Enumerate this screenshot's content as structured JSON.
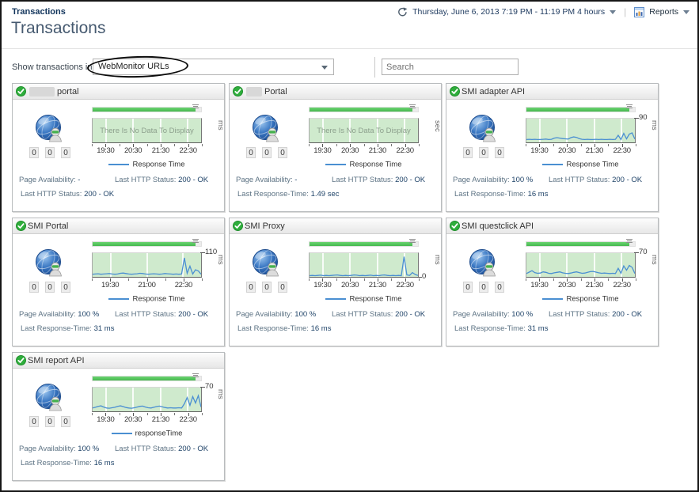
{
  "page": {
    "breadcrumb": "Transactions",
    "title": "Transactions",
    "time_range": "Thursday, June 6, 2013 7:19 PM - 11:19 PM 4 hours",
    "reports_label": "Reports",
    "filter_label": "Show transactions in",
    "filter_value": "WebMonitor URLs",
    "search_placeholder": "Search"
  },
  "colors": {
    "status_green": "#2fae3c",
    "availability_green": "#46b84f",
    "chart_background_green": "#cfeacd",
    "response_line_blue": "#4a8fd2",
    "value_navy": "#1f4368",
    "label_gray": "#5d7384"
  },
  "cards": [
    {
      "title": "portal",
      "redacted_width": 32,
      "alarm_counts": [
        "0",
        "0",
        "0"
      ],
      "stats": {
        "availability_label": "Page Availability:",
        "availability_value": "-",
        "http_label": "Last HTTP Status:",
        "http_value": "200 - OK",
        "extra_label": "Last HTTP Status:",
        "extra_value": "200 - OK"
      },
      "chart": {
        "type": "line",
        "no_data": true,
        "no_data_text": "There Is No Data To Display",
        "unit": "ms",
        "y_top_label": "",
        "y_bottom_label": "",
        "x_ticks": [
          "19:30",
          "20:30",
          "21:30",
          "22:30"
        ],
        "legend": "Response Time",
        "values_pct": []
      }
    },
    {
      "title": "Portal",
      "redacted_width": 20,
      "alarm_counts": [
        "0",
        "0",
        "0"
      ],
      "stats": {
        "availability_label": "Page Availability:",
        "availability_value": "-",
        "http_label": "Last HTTP Status:",
        "http_value": "200 - OK",
        "extra_label": "Last Response-Time:",
        "extra_value": "1.49 sec"
      },
      "chart": {
        "type": "line",
        "no_data": true,
        "no_data_text": "There Is No Data To Display",
        "unit": "sec",
        "y_top_label": "",
        "y_bottom_label": "",
        "x_ticks": [
          "19:30",
          "20:30",
          "21:30",
          "22:30"
        ],
        "legend": "Response Time",
        "values_pct": []
      }
    },
    {
      "title": "SMI adapter API",
      "redacted_width": 0,
      "alarm_counts": [
        "0",
        "0",
        "0"
      ],
      "stats": {
        "availability_label": "Page Availability:",
        "availability_value": "100 %",
        "http_label": "Last HTTP Status:",
        "http_value": "200 - OK",
        "extra_label": "Last Response-Time:",
        "extra_value": "16 ms"
      },
      "chart": {
        "type": "line",
        "no_data": false,
        "no_data_text": "",
        "unit": "ms",
        "y_top_label": "90",
        "y_bottom_label": "",
        "x_ticks": [
          "19:30",
          "20:30",
          "21:30",
          "22:30"
        ],
        "legend": "Response Time",
        "values_pct": [
          12,
          13,
          12,
          13,
          12,
          12,
          13,
          14,
          12,
          13,
          18,
          20,
          18,
          16,
          15,
          14,
          20,
          23,
          21,
          16,
          13,
          12,
          13,
          12,
          12,
          13,
          12,
          13,
          12,
          12,
          13,
          12,
          13,
          30,
          12,
          38,
          15,
          35,
          40,
          14
        ]
      }
    },
    {
      "title": "SMI Portal",
      "redacted_width": 0,
      "alarm_counts": [
        "0",
        "0",
        "0"
      ],
      "stats": {
        "availability_label": "Page Availability:",
        "availability_value": "100 %",
        "http_label": "Last HTTP Status:",
        "http_value": "200 - OK",
        "extra_label": "Last Response-Time:",
        "extra_value": "31 ms"
      },
      "chart": {
        "type": "line",
        "no_data": false,
        "no_data_text": "",
        "unit": "ms",
        "y_top_label": "110",
        "y_bottom_label": "",
        "x_ticks": [
          "19:30",
          "21:00",
          "22:30"
        ],
        "legend": "Response Time",
        "values_pct": [
          11,
          12,
          13,
          11,
          12,
          13,
          14,
          12,
          11,
          12,
          15,
          16,
          14,
          12,
          11,
          12,
          13,
          15,
          14,
          12,
          11,
          12,
          13,
          12,
          11,
          12,
          14,
          13,
          12,
          11,
          12,
          11,
          12,
          80,
          15,
          45,
          12,
          30,
          25,
          11
        ]
      }
    },
    {
      "title": "SMI Proxy",
      "redacted_width": 0,
      "alarm_counts": [
        "0",
        "0",
        "0"
      ],
      "stats": {
        "availability_label": "Page Availability:",
        "availability_value": "100 %",
        "http_label": "Last HTTP Status:",
        "http_value": "200 - OK",
        "extra_label": "Last Response-Time:",
        "extra_value": "16 ms"
      },
      "chart": {
        "type": "line",
        "no_data": false,
        "no_data_text": "",
        "unit": "ms",
        "y_top_label": "",
        "y_bottom_label": "0",
        "x_ticks": [
          "19:30",
          "20:30",
          "21:30",
          "22:30"
        ],
        "legend": "Response Time",
        "values_pct": [
          5,
          6,
          5,
          6,
          7,
          5,
          6,
          5,
          6,
          7,
          8,
          6,
          5,
          6,
          5,
          6,
          8,
          7,
          5,
          6,
          5,
          6,
          7,
          5,
          6,
          5,
          7,
          8,
          6,
          5,
          6,
          5,
          6,
          5,
          85,
          8,
          6,
          18,
          10,
          6
        ]
      }
    },
    {
      "title": "SMI questclick API",
      "redacted_width": 0,
      "alarm_counts": [
        "0",
        "0",
        "0"
      ],
      "stats": {
        "availability_label": "Page Availability:",
        "availability_value": "100 %",
        "http_label": "Last HTTP Status:",
        "http_value": "200 - OK",
        "extra_label": "Last Response-Time:",
        "extra_value": "31 ms"
      },
      "chart": {
        "type": "line",
        "no_data": false,
        "no_data_text": "",
        "unit": "ms",
        "y_top_label": "70",
        "y_bottom_label": "",
        "x_ticks": [
          "19:30",
          "20:30",
          "21:30",
          "22:30"
        ],
        "legend": "Response Time",
        "values_pct": [
          14,
          20,
          26,
          18,
          15,
          16,
          21,
          19,
          15,
          14,
          17,
          19,
          21,
          17,
          15,
          14,
          16,
          19,
          21,
          18,
          15,
          16,
          19,
          22,
          23,
          20,
          17,
          15,
          16,
          15,
          14,
          15,
          14,
          36,
          15,
          46,
          28,
          48,
          40,
          14
        ]
      }
    },
    {
      "title": "SMI report API",
      "redacted_width": 0,
      "alarm_counts": [
        "0",
        "0",
        "0"
      ],
      "stats": {
        "availability_label": "Page Availability:",
        "availability_value": "100 %",
        "http_label": "Last HTTP Status:",
        "http_value": "200 - OK",
        "extra_label": "Last Response-Time:",
        "extra_value": "16 ms"
      },
      "chart": {
        "type": "line",
        "no_data": false,
        "no_data_text": "",
        "unit": "ms",
        "y_top_label": "70",
        "y_bottom_label": "",
        "x_ticks": [
          "19:30",
          "20:30",
          "21:30",
          "22:30"
        ],
        "legend": "responseTime",
        "values_pct": [
          14,
          17,
          21,
          23,
          18,
          14,
          13,
          15,
          17,
          21,
          23,
          20,
          16,
          14,
          13,
          15,
          18,
          21,
          22,
          18,
          15,
          14,
          17,
          20,
          22,
          19,
          16,
          14,
          15,
          14,
          14,
          15,
          14,
          32,
          58,
          25,
          62,
          35,
          66,
          18
        ]
      }
    }
  ]
}
